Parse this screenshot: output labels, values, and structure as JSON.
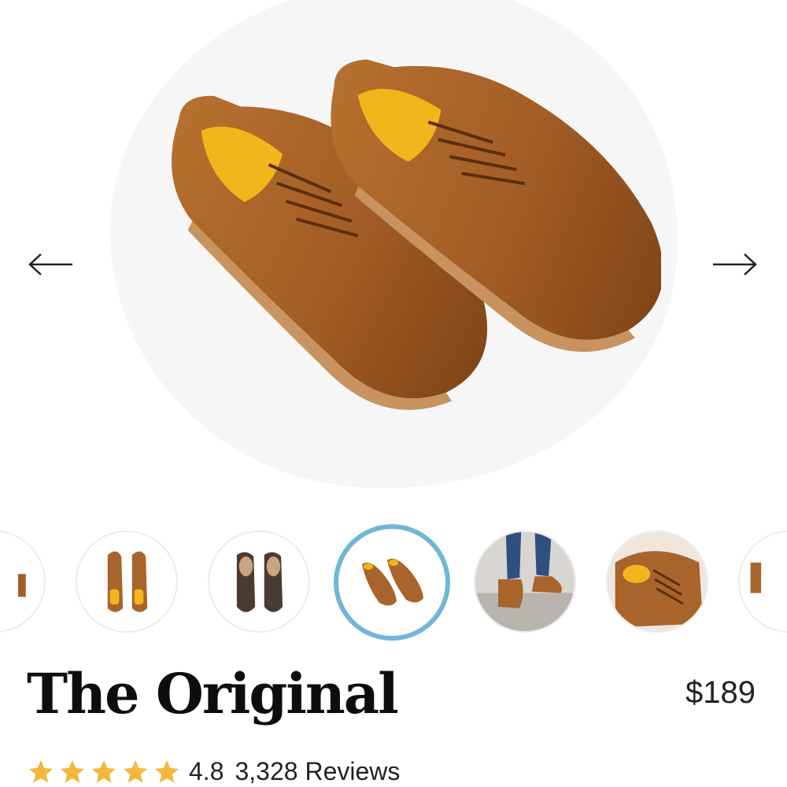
{
  "product": {
    "title": "The Original",
    "price": "$189",
    "rating": "4.8",
    "rating_value": 4.8,
    "stars_shown": 5,
    "review_count": "3,328",
    "reviews_label": "Reviews"
  },
  "gallery": {
    "active_index": 2,
    "thumbnails": [
      {
        "name": "thumb-shoes-top-view"
      },
      {
        "name": "thumb-shoes-soles"
      },
      {
        "name": "thumb-shoes-angled"
      },
      {
        "name": "thumb-shoes-on-feet"
      },
      {
        "name": "thumb-shoe-detail"
      }
    ],
    "prev_icon": "arrow-left-icon",
    "next_icon": "arrow-right-icon"
  },
  "colors": {
    "leather": "#a8642b",
    "insole": "#f2b51c",
    "star": "#f4b63c",
    "active_ring": "#6fb6d8"
  }
}
